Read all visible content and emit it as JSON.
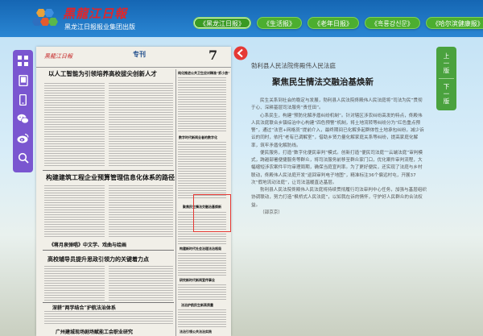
{
  "header": {
    "logo_title": "黑龍江日報",
    "logo_subtitle": "黑龙江日报报业集团出版",
    "nav": [
      {
        "label": "《黑龙江日报》",
        "active": true
      },
      {
        "label": "《生活报》",
        "active": false
      },
      {
        "label": "《老年日报》",
        "active": false
      },
      {
        "label": "《흑룡강신문》",
        "active": false
      },
      {
        "label": "《哈尔滨健康报》",
        "active": false
      }
    ]
  },
  "toolbar": {
    "icons": [
      "grid-icon",
      "tablet-icon",
      "phone-icon",
      "wechat-icon",
      "weibo-icon",
      "search-icon"
    ]
  },
  "newspaper": {
    "brand": "黑龍江日報",
    "special_label": "专刊",
    "page_number": "7",
    "headlines": [
      "以人工智能为引领培养高校拔尖创新人才",
      "构建建筑工程企业预算管理信息化体系的路径",
      "《蒋月泉弹唱》中文学、戏曲与绘画",
      "高校辅导员提升思政引领力的关键着力点",
      "深耕“两学结合”护航法治体系",
      "广州建城现场剧场赋能工会职业研究"
    ],
    "side_headlines": [
      "纯化推进公共卫生应对精准“抓小放”",
      "数字时代新闻业者的数字化",
      "聚焦民生情法交融治基焕新",
      "构建新时代社会治理法治格局",
      "研究新时代新闻宣传事业",
      "法治护航民生新高质量",
      "法治引领公共法治实践"
    ],
    "highlight_color": "#e53935"
  },
  "article": {
    "kicker": "勃利县人民法院佟殿伟人民法庭",
    "title": "聚焦民生情法交融治基焕新",
    "paragraphs": [
      "民生关系到社会的稳定与发展，勃利县人民法院佟殿伟人民法庭将“司法为民”贯彻于心、深耕基层司法服务“责任田”。",
      "心系民生，构建“预防化解矛盾纠纷机制”。针对辖区涉农纠纷高发的特点，佟殿伟人民法庭联合乡镇综治中心构建“四色预警”机制，将土地流转等纠纷分为“红色重点预警”，通过“法官+网格员”提前介入，最终期间已化解多起群体性土地承包纠纷，减少诉讼的同时，依托“老有已调解室”，借助乡贤力量化解家庭关系等纠纷，提高家庭化解率，筑牢矛盾化解防线。",
      "便民服务，打造“数字化便民审判”模式。创新打造“便民司法庭”“云端法庭”审判模式，跨越部署便捷服务等群众，将司法服务前移至群众家门口，优化案件审判流程，大幅缩短涉农案件平均审理周期，确保当庭宣判率。为了更好便民，还实现了法庭与乡村联动，佟殿伟人民法庭开发“巡回审判电子地图”，精准标注36个偏远村屯，开展37次“假地流动法庭”，让司法温暖直达基层。",
      "勃利县人民法院佟殿伟人民法庭将持续贯彻履行司法审判中心任务，加强与基层组织协调联动，努力打造“枫桥式人民法庭”，以如我在诉的情怀，守护好人民群众的合法权益。",
      "（邵京京）"
    ]
  },
  "page_buttons": {
    "prev": "上一版",
    "next": "下一版"
  },
  "colors": {
    "header_blue": "#1566b3",
    "nav_green": "#4cae2f",
    "toolbar_purple": "#7a56d0",
    "page_btn_green": "#4aa23e",
    "marker_red": "#e53935"
  }
}
